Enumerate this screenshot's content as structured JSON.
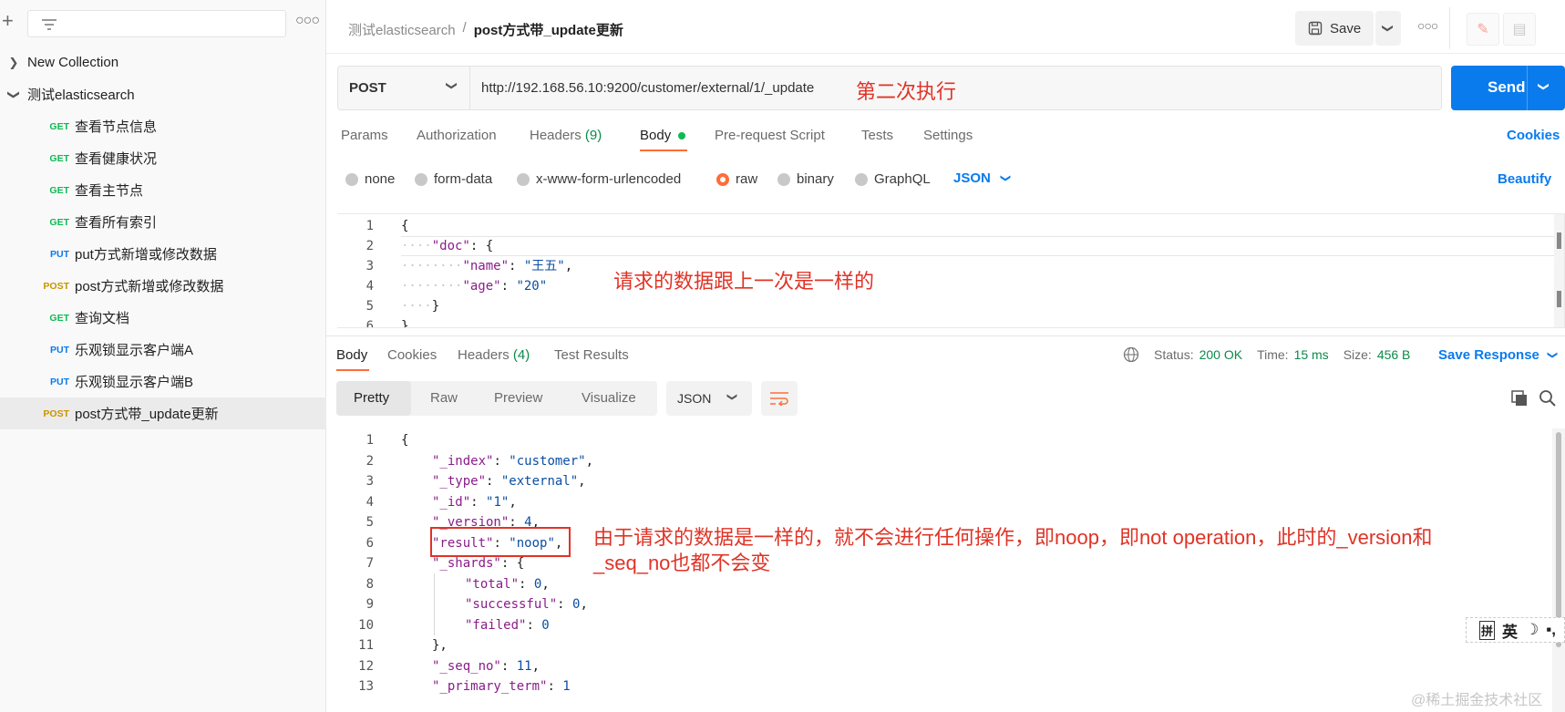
{
  "sidebar": {
    "tree": [
      {
        "label": "New Collection",
        "type": "collection",
        "expanded": false
      },
      {
        "label": "测试elasticsearch",
        "type": "collection",
        "expanded": true
      }
    ],
    "requests": [
      {
        "method": "GET",
        "label": "查看节点信息"
      },
      {
        "method": "GET",
        "label": "查看健康状况"
      },
      {
        "method": "GET",
        "label": "查看主节点"
      },
      {
        "method": "GET",
        "label": "查看所有索引"
      },
      {
        "method": "PUT",
        "label": "put方式新增或修改数据"
      },
      {
        "method": "POST",
        "label": "post方式新增或修改数据"
      },
      {
        "method": "GET",
        "label": "查询文档"
      },
      {
        "method": "PUT",
        "label": "乐观锁显示客户端A"
      },
      {
        "method": "PUT",
        "label": "乐观锁显示客户端B"
      },
      {
        "method": "POST",
        "label": "post方式带_update更新",
        "selected": true
      }
    ]
  },
  "header": {
    "breadcrumb_parent": "测试elasticsearch",
    "breadcrumb_sep": "/",
    "breadcrumb_current": "post方式带_update更新",
    "save_label": "Save",
    "more_label": "⋯"
  },
  "request": {
    "method": "POST",
    "url": "http://192.168.56.10:9200/customer/external/1/_update",
    "annotation": "第二次执行",
    "send_label": "Send"
  },
  "request_tabs": [
    {
      "label": "Params"
    },
    {
      "label": "Authorization"
    },
    {
      "label": "Headers",
      "count": "(9)"
    },
    {
      "label": "Body",
      "active": true
    },
    {
      "label": "Pre-request Script"
    },
    {
      "label": "Tests"
    },
    {
      "label": "Settings"
    }
  ],
  "cookies_label": "Cookies",
  "body_modes": [
    "none",
    "form-data",
    "x-www-form-urlencoded",
    "raw",
    "binary",
    "GraphQL"
  ],
  "body_mode_selected": "raw",
  "body_format": "JSON",
  "beautify_label": "Beautify",
  "request_body": {
    "line_numbers": [
      "1",
      "2",
      "3",
      "4",
      "5",
      "6"
    ],
    "annotation": "请求的数据跟上一次是一样的",
    "doc_key": "\"doc\"",
    "name_key": "\"name\"",
    "name_value": "\"王五\"",
    "age_key": "\"age\"",
    "age_value": "\"20\""
  },
  "response_tabs": [
    {
      "label": "Body",
      "active": true
    },
    {
      "label": "Cookies"
    },
    {
      "label": "Headers",
      "count": "(4)"
    },
    {
      "label": "Test Results"
    }
  ],
  "response_meta": {
    "status_label": "Status:",
    "status_value": "200 OK",
    "time_label": "Time:",
    "time_value": "15 ms",
    "size_label": "Size:",
    "size_value": "456 B",
    "save_response_label": "Save Response"
  },
  "view_tabs": [
    "Pretty",
    "Raw",
    "Preview",
    "Visualize"
  ],
  "view_format": "JSON",
  "response_body": {
    "line_numbers": [
      "1",
      "2",
      "3",
      "4",
      "5",
      "6",
      "7",
      "8",
      "9",
      "10",
      "11",
      "12",
      "13"
    ],
    "index_key": "\"_index\"",
    "index_value": "\"customer\"",
    "type_key": "\"_type\"",
    "type_value": "\"external\"",
    "id_key": "\"_id\"",
    "id_value": "\"1\"",
    "version_key": "\"_version\"",
    "version_value": "4",
    "result_key": "\"result\"",
    "result_value": "\"noop\"",
    "shards_key": "\"_shards\"",
    "total_key": "\"total\"",
    "total_value": "0",
    "successful_key": "\"successful\"",
    "successful_value": "0",
    "failed_key": "\"failed\"",
    "failed_value": "0",
    "seq_key": "\"_seq_no\"",
    "seq_value": "11",
    "primary_key": "\"_primary_term\"",
    "primary_value": "1",
    "annotation_line1": "由于请求的数据是一样的，就不会进行任何操作，即noop，即not operation，此时的_version和",
    "annotation_line2": "_seq_no也都不会变"
  },
  "ime_toolbar": {
    "label1": "拼",
    "label2": "英"
  },
  "watermark": "@稀土掘金技术社区",
  "colors": {
    "accent": "#097bed",
    "orange": "#ff6c37",
    "status_green": "#0a8a4a",
    "annotation_red": "#e03326"
  }
}
